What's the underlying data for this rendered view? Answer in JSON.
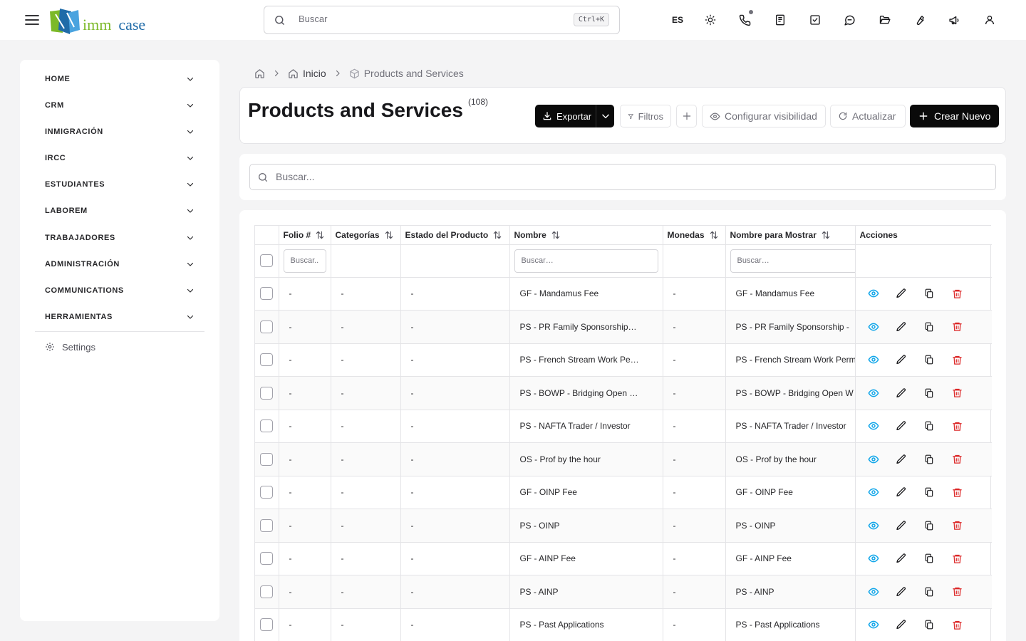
{
  "header": {
    "logo_text_1": "imm",
    "logo_text_2": "case",
    "search_placeholder": "Buscar",
    "search_shortcut": "Ctrl+K",
    "language": "ES",
    "icons": [
      "sun-icon",
      "phone-icon",
      "notes-icon",
      "tasks-icon",
      "messages-icon",
      "folder-icon",
      "wrench-icon",
      "megaphone-icon",
      "user-icon"
    ]
  },
  "sidebar": {
    "items": [
      {
        "label": "HOME"
      },
      {
        "label": "CRM"
      },
      {
        "label": "INMIGRACIÓN"
      },
      {
        "label": "IRCC"
      },
      {
        "label": "ESTUDIANTES"
      },
      {
        "label": "LABOREM"
      },
      {
        "label": "TRABAJADORES"
      },
      {
        "label": "ADMINISTRACIÓN"
      },
      {
        "label": "COMMUNICATIONS"
      },
      {
        "label": "HERRAMIENTAS"
      }
    ],
    "settings_label": "Settings"
  },
  "breadcrumb": {
    "home": "Inicio",
    "current": "Products and Services"
  },
  "page": {
    "title": "Products and Services",
    "count": "(108)",
    "export_label": "Exportar",
    "filters_label": "Filtros",
    "visibility_label": "Configurar visibilidad",
    "refresh_label": "Actualizar",
    "create_label": "Crear Nuevo",
    "search_placeholder": "Buscar..."
  },
  "table": {
    "columns": [
      "Folio #",
      "Categorías",
      "Estado del Producto",
      "Nombre",
      "Monedas",
      "Nombre para Mostrar",
      "Acciones"
    ],
    "filter_placeholder_short": "Buscar...",
    "filter_placeholder": "Buscar…",
    "rows": [
      {
        "folio": "-",
        "categorias": "-",
        "estado": "-",
        "nombre": "GF - Mandamus Fee",
        "monedas": "-",
        "mostrar": "GF - Mandamus Fee"
      },
      {
        "folio": "-",
        "categorias": "-",
        "estado": "-",
        "nombre": "PS - PR Family Sponsorship…",
        "monedas": "-",
        "mostrar": "PS - PR Family Sponsorship -"
      },
      {
        "folio": "-",
        "categorias": "-",
        "estado": "-",
        "nombre": "PS - French Stream Work Pe…",
        "monedas": "-",
        "mostrar": "PS - French Stream Work Perm"
      },
      {
        "folio": "-",
        "categorias": "-",
        "estado": "-",
        "nombre": "PS - BOWP - Bridging Open …",
        "monedas": "-",
        "mostrar": "PS - BOWP - Bridging Open W"
      },
      {
        "folio": "-",
        "categorias": "-",
        "estado": "-",
        "nombre": "PS - NAFTA Trader / Investor",
        "monedas": "-",
        "mostrar": "PS - NAFTA Trader / Investor"
      },
      {
        "folio": "-",
        "categorias": "-",
        "estado": "-",
        "nombre": "OS - Prof by the hour",
        "monedas": "-",
        "mostrar": "OS - Prof by the hour"
      },
      {
        "folio": "-",
        "categorias": "-",
        "estado": "-",
        "nombre": "GF - OINP Fee",
        "monedas": "-",
        "mostrar": "GF - OINP Fee"
      },
      {
        "folio": "-",
        "categorias": "-",
        "estado": "-",
        "nombre": "PS - OINP",
        "monedas": "-",
        "mostrar": "PS - OINP"
      },
      {
        "folio": "-",
        "categorias": "-",
        "estado": "-",
        "nombre": "GF - AINP Fee",
        "monedas": "-",
        "mostrar": "GF - AINP Fee"
      },
      {
        "folio": "-",
        "categorias": "-",
        "estado": "-",
        "nombre": "PS - AINP",
        "monedas": "-",
        "mostrar": "PS - AINP"
      },
      {
        "folio": "-",
        "categorias": "-",
        "estado": "-",
        "nombre": "PS - Past Applications",
        "monedas": "-",
        "mostrar": "PS - Past Applications"
      }
    ]
  },
  "colors": {
    "view_icon": "#0ea5e9",
    "delete_icon": "#dc2626",
    "primary_button": "#0a0a0a",
    "logo_green": "#7cb928",
    "logo_blue": "#1f6ba8"
  }
}
